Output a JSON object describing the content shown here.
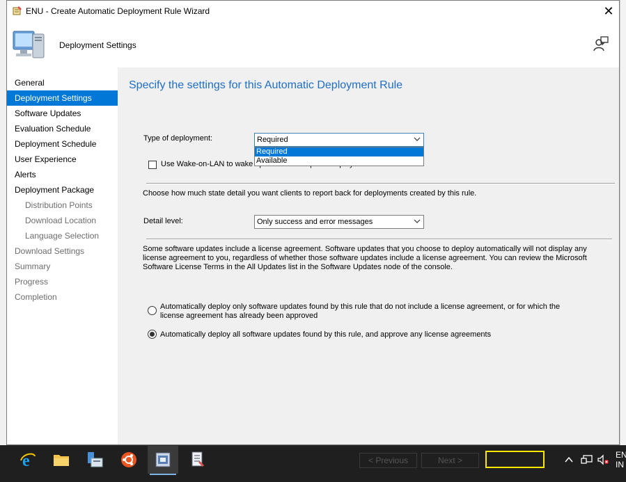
{
  "window": {
    "title": "ENU - Create Automatic Deployment Rule Wizard",
    "close_glyph": "✕"
  },
  "header": {
    "title": "Deployment Settings"
  },
  "sidebar": {
    "items": [
      {
        "label": "General",
        "state": "normal"
      },
      {
        "label": "Deployment Settings",
        "state": "active"
      },
      {
        "label": "Software Updates",
        "state": "normal"
      },
      {
        "label": "Evaluation Schedule",
        "state": "normal"
      },
      {
        "label": "Deployment Schedule",
        "state": "normal"
      },
      {
        "label": "User Experience",
        "state": "normal"
      },
      {
        "label": "Alerts",
        "state": "normal"
      },
      {
        "label": "Deployment Package",
        "state": "normal"
      },
      {
        "label": "Distribution Points",
        "state": "dim-sub"
      },
      {
        "label": "Download Location",
        "state": "dim-sub"
      },
      {
        "label": "Language Selection",
        "state": "dim-sub"
      },
      {
        "label": "Download Settings",
        "state": "dim"
      },
      {
        "label": "Summary",
        "state": "dim"
      },
      {
        "label": "Progress",
        "state": "dim"
      },
      {
        "label": "Completion",
        "state": "dim"
      }
    ]
  },
  "content": {
    "heading": "Specify the settings for this Automatic Deployment Rule",
    "type_of_deployment": {
      "label": "Type of deployment:",
      "value": "Required",
      "options": [
        "Required",
        "Available"
      ],
      "highlighted": "Required"
    },
    "wake_on_lan": {
      "label": "Use Wake-on-LAN to wake up clients for required deployments",
      "checked": false
    },
    "state_detail_text": "Choose how much state detail you want clients to report back for deployments created by this rule.",
    "detail_level": {
      "label": "Detail level:",
      "value": "Only success and error messages"
    },
    "license_text": "Some software updates include a license agreement. Software updates that you choose to deploy automatically will not display any license agreement to you, regardless of whether those software updates include a license agreement. You can review the Microsoft Software License Terms in the All Updates list in the Software Updates node of the console.",
    "license_options": [
      {
        "label": "Automatically deploy only software updates found by this rule that do not include a license agreement, or for which the license agreement has already been approved",
        "selected": false
      },
      {
        "label": "Automatically deploy all software updates found by this rule, and approve any license agreements",
        "selected": true
      }
    ]
  },
  "footer": {
    "previous_label": "< Previous",
    "next_label": "Next >"
  },
  "taskbar": {
    "apps": [
      "internet-explorer-icon",
      "file-explorer-icon",
      "server-manager-icon",
      "ubuntu-icon",
      "config-manager-console-icon",
      "document-icon"
    ],
    "active_index": 4,
    "language": [
      "EN",
      "IN"
    ]
  },
  "colors": {
    "accent": "#0078d7",
    "heading": "#1f6ec4",
    "highlight_box": "#ffe800"
  }
}
